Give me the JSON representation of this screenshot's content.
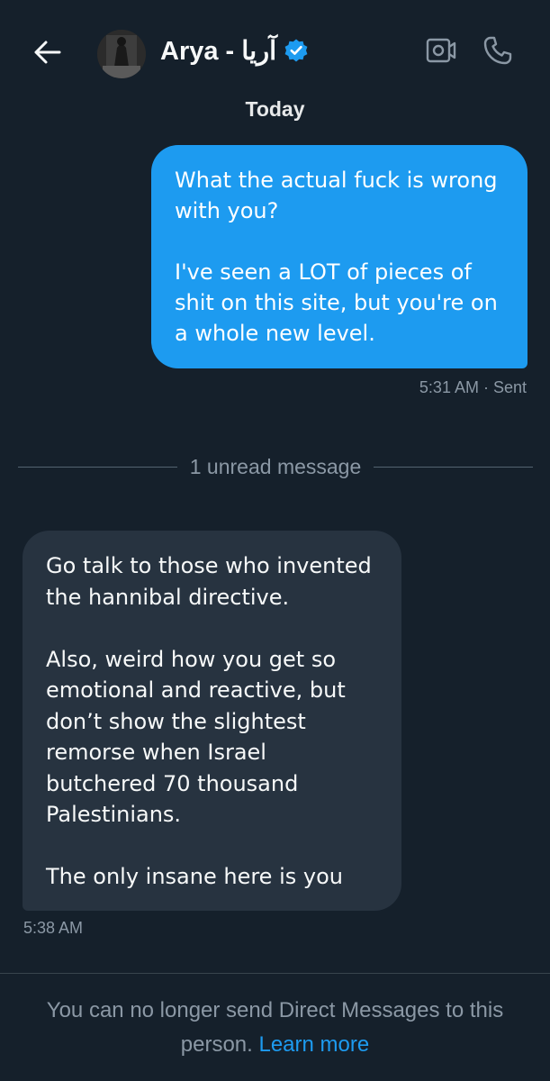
{
  "header": {
    "title": "Arya - آریا",
    "back_icon": "arrow-left-icon",
    "verified_icon": "verified-badge-icon",
    "video_icon": "video-camera-icon",
    "call_icon": "phone-icon"
  },
  "date_label": "Today",
  "messages": [
    {
      "direction": "sent",
      "text": "What the actual fuck is wrong\nwith you?\n\nI've seen a LOT of pieces of\nshit on this site, but you're on\na whole new level.",
      "meta": "5:31 AM · Sent"
    },
    {
      "direction": "received",
      "text": "Go talk to those who invented\nthe hannibal directive.\n\nAlso, weird how you get so\nemotional and reactive, but\ndon’t show the slightest\nremorse when Israel\nbutchered 70 thousand\nPalestinians.\n\nThe only insane here is you",
      "meta": "5:38 AM"
    }
  ],
  "unread_divider": "1 unread message",
  "footer": {
    "notice": "You can no longer send Direct Messages to this person. ",
    "learn_more": "Learn more"
  },
  "colors": {
    "background": "#15202b",
    "sent_bubble": "#1d9bf0",
    "received_bubble": "#273340",
    "muted_text": "#8b98a5",
    "link": "#1d9bf0"
  }
}
